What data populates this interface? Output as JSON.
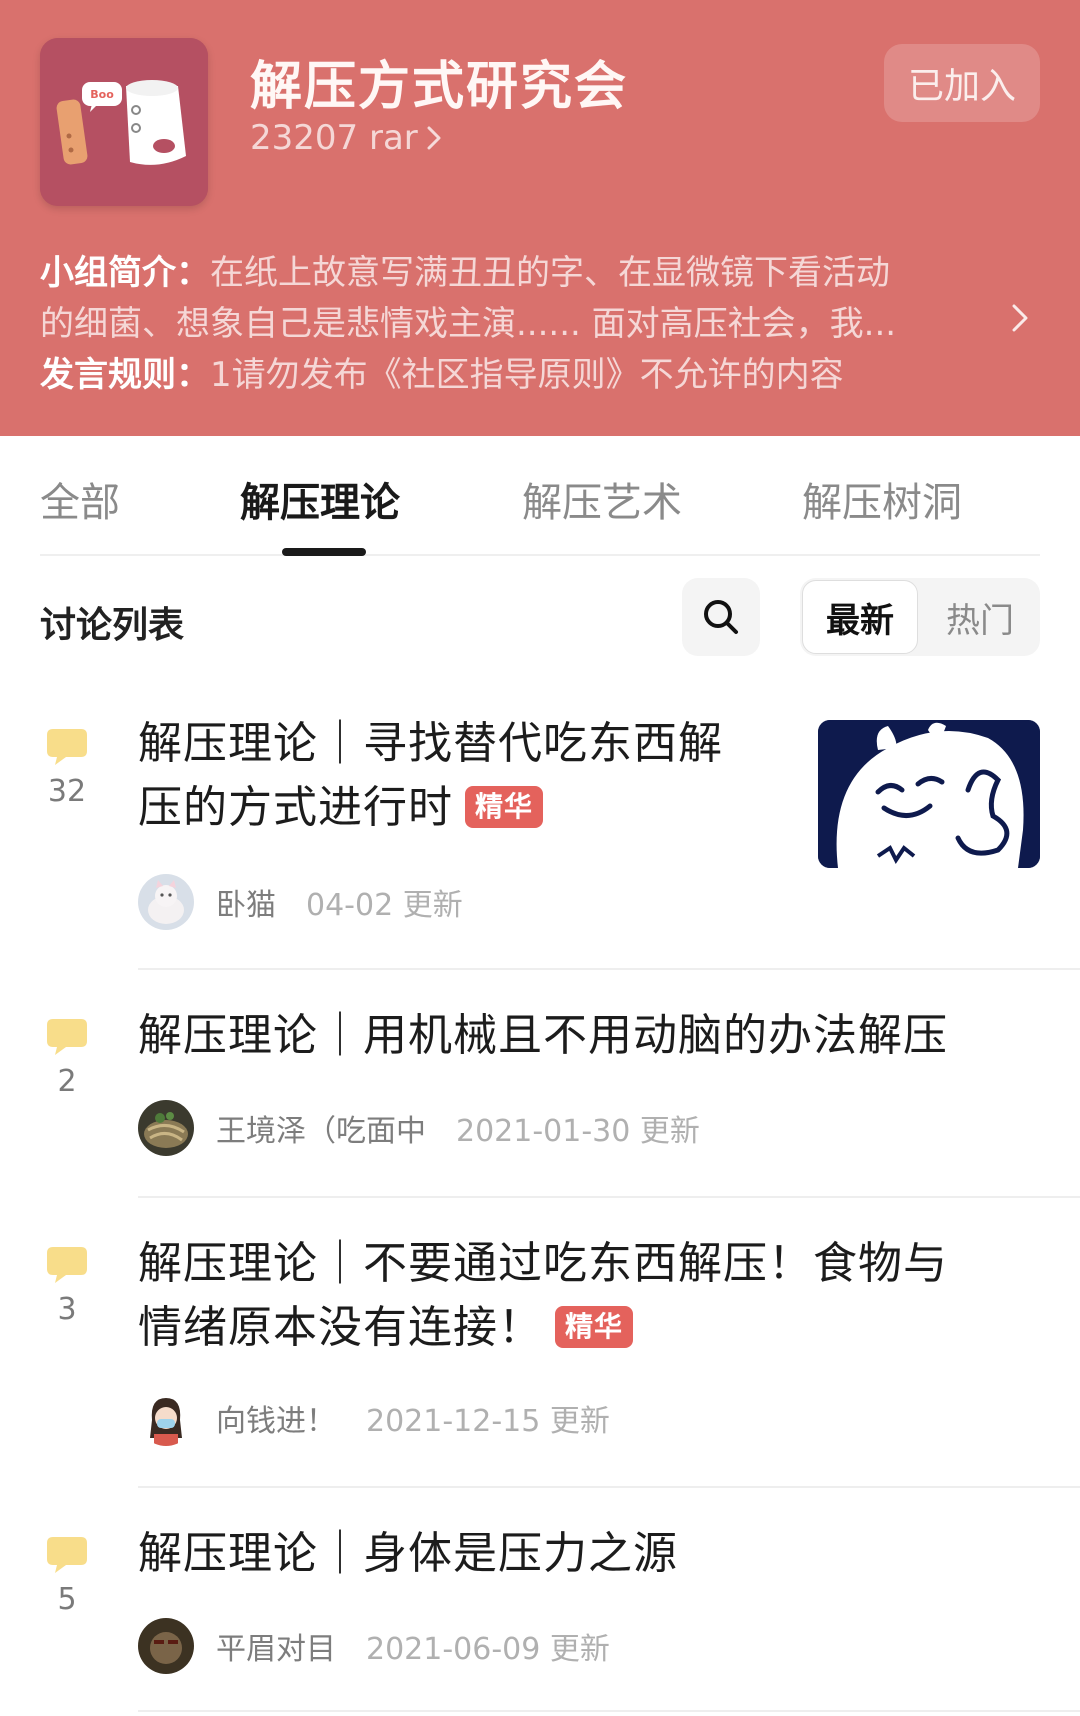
{
  "group": {
    "name": "解压方式研究会",
    "count": "23207 rar",
    "join_label": "已加入",
    "avatar_badge": "Boo",
    "intro_label": "小组简介：",
    "intro_line1": "在纸上故意写满丑丑的字、在显微镜下看活动",
    "intro_line2": "的细菌、想象自己是悲情戏主演...... 面对高压社会，我...",
    "rules_label": "发言规则：",
    "rules_text": "1请勿发布《社区指导原则》不允许的内容"
  },
  "tabs": [
    {
      "label": "全部",
      "active": false
    },
    {
      "label": "解压理论",
      "active": true
    },
    {
      "label": "解压艺术",
      "active": false
    },
    {
      "label": "解压树洞",
      "active": false
    }
  ],
  "list": {
    "title": "讨论列表",
    "sort_newest": "最新",
    "sort_hot": "热门"
  },
  "posts": [
    {
      "comments": "32",
      "title_line1": "解压理论｜寻找替代吃东西解",
      "title_line2": "压的方式进行时",
      "badge": "精华",
      "author": "卧猫",
      "updated": "04-02 更新",
      "has_thumb": true
    },
    {
      "comments": "2",
      "title_line1": "解压理论｜用机械且不用动脑的办法解压",
      "author": "王境泽（吃面中",
      "updated": "2021-01-30 更新"
    },
    {
      "comments": "3",
      "title_line1": "解压理论｜不要通过吃东西解压！食物与",
      "title_line2": "情绪原本没有连接！",
      "badge": "精华",
      "author": "向钱进！",
      "updated": "2021-12-15 更新"
    },
    {
      "comments": "5",
      "title_line1": "解压理论｜身体是压力之源",
      "author": "平眉对目",
      "updated": "2021-06-09 更新"
    }
  ],
  "colors": {
    "header_bg": "#d9716d",
    "badge_bg": "#e4625c",
    "comment_icon": "#f8dd8a"
  },
  "icons": {
    "count_chevron": "chevron-right-icon",
    "intro_chevron": "chevron-right-icon",
    "search": "search-icon",
    "comment": "comment-bubble-icon"
  }
}
